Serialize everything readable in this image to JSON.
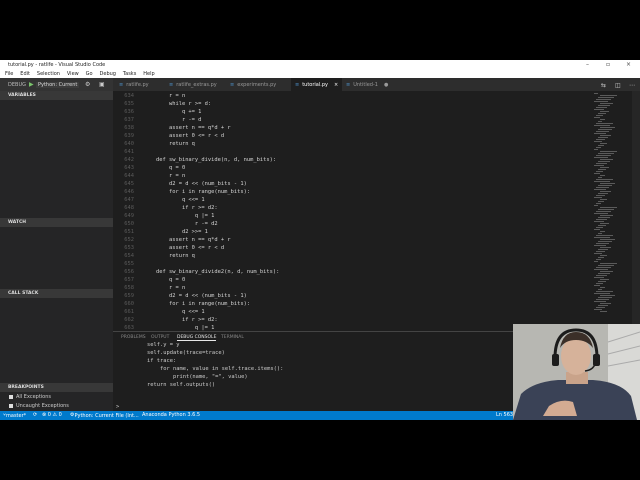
{
  "window": {
    "title": "tutorial.py - ratlife - Visual Studio Code"
  },
  "menu": [
    "File",
    "Edit",
    "Selection",
    "View",
    "Go",
    "Debug",
    "Tasks",
    "Help"
  ],
  "debug": {
    "label": "DEBUG",
    "config": "Python: Current"
  },
  "sidebar": {
    "sections": [
      "VARIABLES",
      "WATCH",
      "CALL STACK",
      "BREAKPOINTS"
    ],
    "breakpoints": [
      "All Exceptions",
      "Uncaught Exceptions"
    ]
  },
  "tabs": [
    {
      "label": "ratlife.py"
    },
    {
      "label": "ratlife_extras.py"
    },
    {
      "label": "experiments.py"
    },
    {
      "label": "tutorial.py",
      "close": "×"
    },
    {
      "label": "Untitled-1",
      "dirty": "●"
    }
  ],
  "code": [
    {
      "n": "634",
      "t": "        r = n"
    },
    {
      "n": "635",
      "t": "        while r >= d:"
    },
    {
      "n": "636",
      "t": "            q += 1"
    },
    {
      "n": "637",
      "t": "            r -= d"
    },
    {
      "n": "638",
      "t": "        assert n == q*d + r"
    },
    {
      "n": "639",
      "t": "        assert 0 <= r < d"
    },
    {
      "n": "640",
      "t": "        return q"
    },
    {
      "n": "641",
      "t": ""
    },
    {
      "n": "642",
      "t": "    def sw_binary_divide(n, d, num_bits):"
    },
    {
      "n": "643",
      "t": "        q = 0"
    },
    {
      "n": "644",
      "t": "        r = n"
    },
    {
      "n": "645",
      "t": "        d2 = d << (num_bits - 1)"
    },
    {
      "n": "646",
      "t": "        for i in range(num_bits):"
    },
    {
      "n": "647",
      "t": "            q <<= 1"
    },
    {
      "n": "648",
      "t": "            if r >= d2:"
    },
    {
      "n": "649",
      "t": "                q |= 1"
    },
    {
      "n": "650",
      "t": "                r -= d2"
    },
    {
      "n": "651",
      "t": "            d2 >>= 1"
    },
    {
      "n": "652",
      "t": "        assert n == q*d + r"
    },
    {
      "n": "653",
      "t": "        assert 0 <= r < d"
    },
    {
      "n": "654",
      "t": "        return q"
    },
    {
      "n": "655",
      "t": ""
    },
    {
      "n": "656",
      "t": "    def sw_binary_divide2(n, d, num_bits):"
    },
    {
      "n": "657",
      "t": "        q = 0"
    },
    {
      "n": "658",
      "t": "        r = n"
    },
    {
      "n": "659",
      "t": "        d2 = d << (num_bits - 1)"
    },
    {
      "n": "660",
      "t": "        for i in range(num_bits):"
    },
    {
      "n": "661",
      "t": "            q <<= 1"
    },
    {
      "n": "662",
      "t": "            if r >= d2:"
    },
    {
      "n": "663",
      "t": "                q |= 1"
    }
  ],
  "panel": {
    "tabs": [
      "PROBLEMS",
      "OUTPUT",
      "DEBUG CONSOLE",
      "TERMINAL"
    ],
    "active": 2
  },
  "console": [
    "self.y = y",
    "self.update(trace=trace)",
    "if trace:",
    "    for name, value in self.trace.items():",
    "        print(name, \"=\", value)",
    "return self.outputs()"
  ],
  "prompt": ">",
  "status": {
    "branch": "master*",
    "counts": "⊗ 0  ⚠ 0",
    "run": "Python: Current File (Int...",
    "interpreter": "Anaconda Python 3.6.5",
    "position": "Ln 563"
  }
}
